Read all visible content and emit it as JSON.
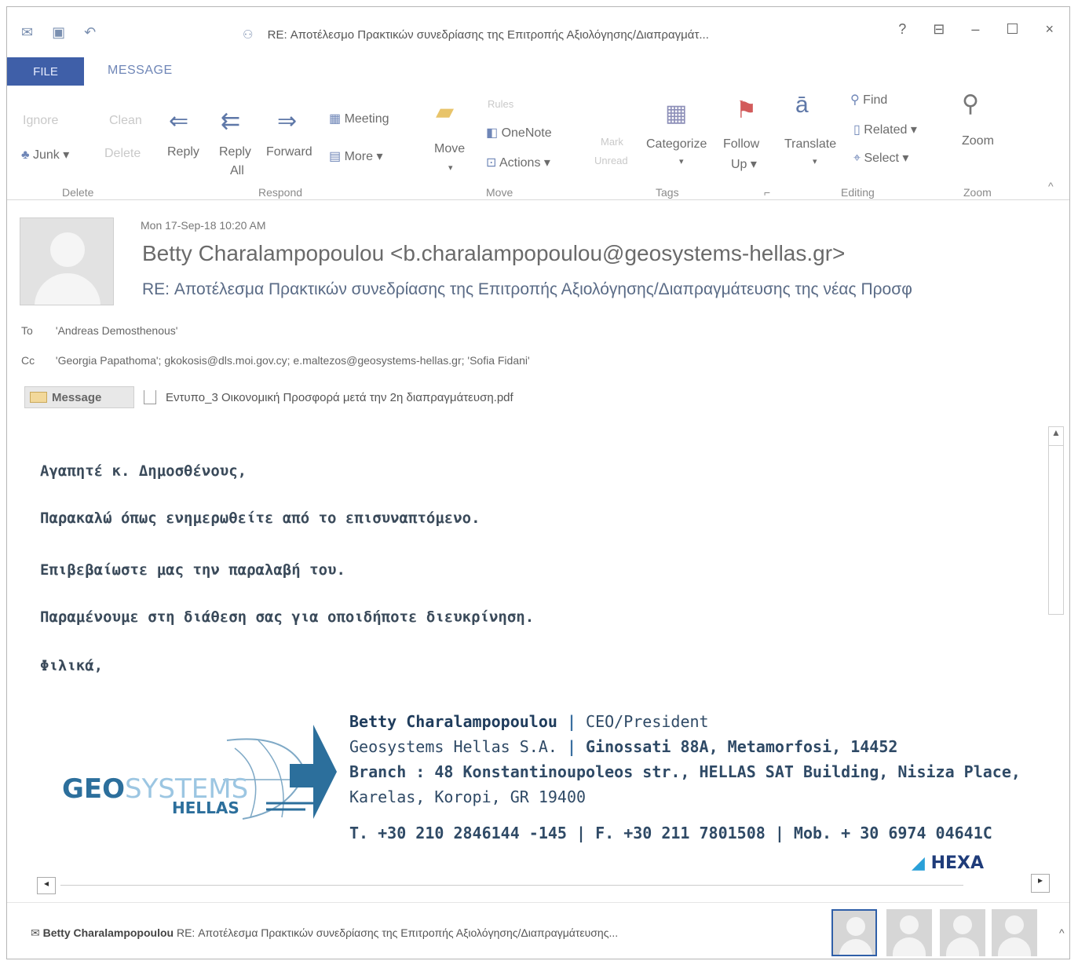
{
  "titlebar": {
    "title": "RE: Αποτέλεσμο Πρακτικών συνεδρίασης της Επιτροπής Αξιολόγησης/Διαπραγμάτ...",
    "help": "?",
    "minimize": "–",
    "maximize": "☐",
    "close": "×"
  },
  "tabs": {
    "file": "FILE",
    "message": "MESSAGE"
  },
  "ribbon": {
    "delete": {
      "ignore": "Ignore",
      "clean_up": "Clean",
      "junk": "Junk ▾",
      "delete": "Delete",
      "label": "Delete"
    },
    "respond": {
      "reply": "Reply",
      "reply_all_1": "Reply",
      "reply_all_2": "All",
      "forward": "Forward",
      "meeting": "Meeting",
      "more": "More ▾",
      "label": "Respond"
    },
    "move": {
      "move": "Move",
      "move_caret": "▾",
      "rules": "Rules",
      "onenote": "OneNote",
      "actions": "Actions ▾",
      "label": "Move"
    },
    "tags": {
      "mark_unread_1": "Mark",
      "mark_unread_2": "Unread",
      "categorize": "Categorize",
      "categorize_caret": "▾",
      "follow_up_1": "Follow",
      "follow_up_2": "Up ▾",
      "label": "Tags",
      "launcher": "⌐"
    },
    "editing": {
      "translate": "Translate",
      "translate_caret": "▾",
      "find": "Find",
      "related": "Related ▾",
      "select": "Select ▾",
      "label": "Editing"
    },
    "zoom": {
      "zoom": "Zoom",
      "label": "Zoom",
      "collapse": "^"
    }
  },
  "header": {
    "sent": "Mon 17-Sep-18 10:20 AM",
    "from": "Betty Charalampopoulou <b.charalampopoulou@geosystems-hellas.gr>",
    "subject": "RE: Αποτέλεσμα Πρακτικών συνεδρίασης της Επιτροπής Αξιολόγησης/Διαπραγμάτευσης της νέας Προσφ",
    "to_label": "To",
    "to": "'Andreas Demosthenous'",
    "cc_label": "Cc",
    "cc": "'Georgia Papathoma'; gkokosis@dls.moi.gov.cy; e.maltezos@geosystems-hellas.gr; 'Sofia Fidani'",
    "message_tab": "Message",
    "attachment": "Εντυπο_3  Οικονομική Προσφορά μετά την 2η διαπραγμάτευση.pdf"
  },
  "body": {
    "greeting": "Αγαπητέ κ. Δημοσθένους,",
    "line1": "Παρακαλώ όπως ενημερωθείτε από το επισυναπτόμενο.",
    "line2": "Επιβεβαίωστε μας την παραλαβή του.",
    "line3": "Παραμένουμε στη διάθεση σας για οποιδήποτε διευκρίνηση.",
    "closing": "Φιλικά,"
  },
  "signature": {
    "name": "Betty Charalampopoulou",
    "sep": "|",
    "role": "CEO/President",
    "company": "Geosystems Hellas S.A.",
    "address": "Ginossati 88A, Metamorfosi, 14452",
    "branch": "Branch : 48 Konstantinoupoleos str., HELLAS SAT Building, Nisiza Place,",
    "branch2": "Karelas, Koropi, GR 19400",
    "phones": "T. +30 210 2846144 -145 | F. +30 211 7801508 | Mob. + 30 6974 04641C",
    "logo_geo": "GEO",
    "logo_systems": "SYSTEMS",
    "logo_hellas": "HELLAS",
    "hexagon_partial": "HEXA"
  },
  "people_pane": {
    "summary_name": "Betty Charalampopoulou",
    "summary_subject": "RE: Αποτέλεσμα Πρακτικών συνεδρίασης της Επιτροπής Αξιολόγησης/Διαπραγμάτευσης...",
    "collapse": "^"
  }
}
